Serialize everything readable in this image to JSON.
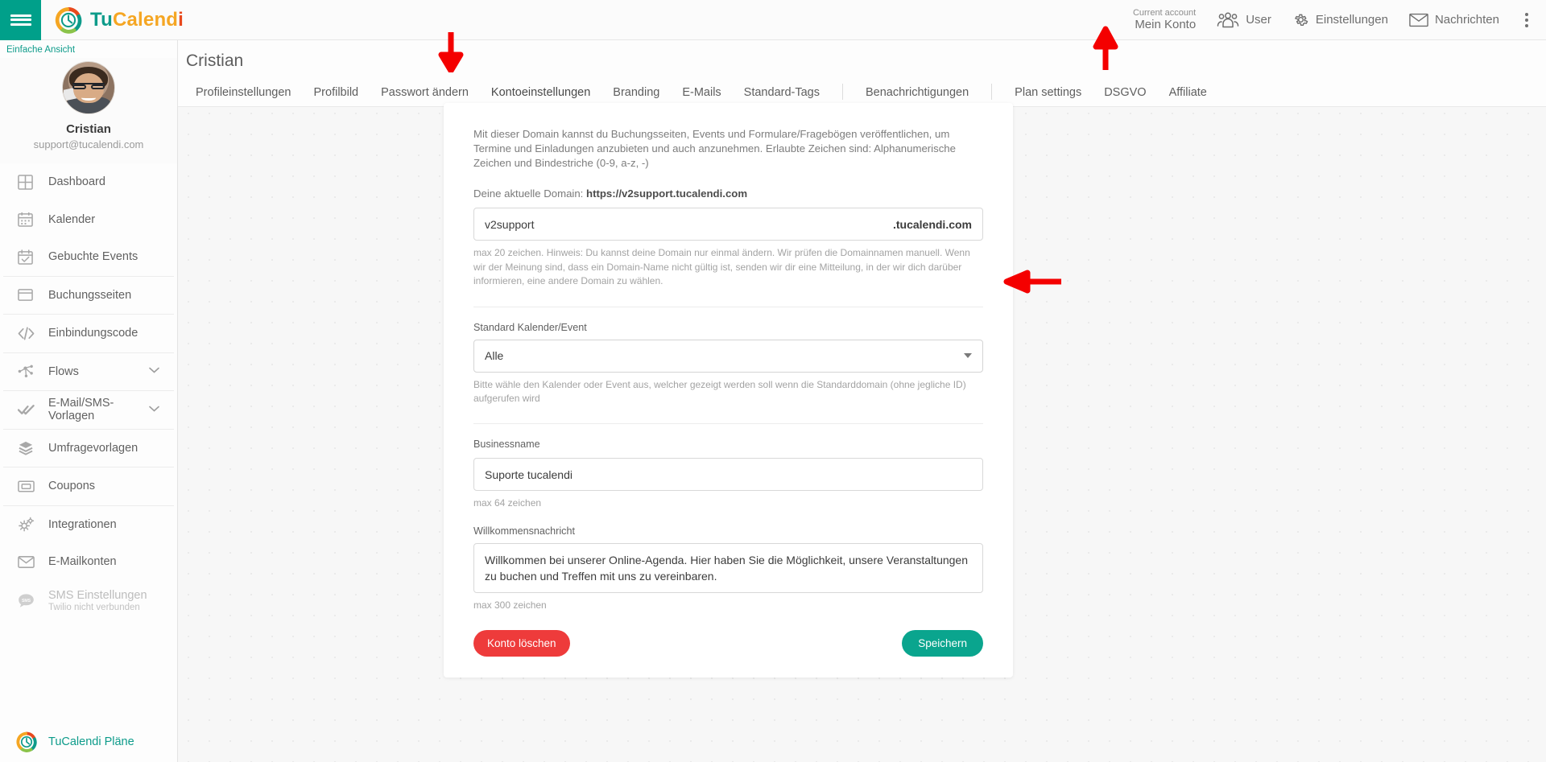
{
  "topbar": {
    "menu_icon": "hamburger-icon",
    "brand": {
      "part1": "Tu",
      "part2": "Calend",
      "part3": "i"
    },
    "account_label": "Current account",
    "account_name": "Mein Konto",
    "items": [
      {
        "label": "User",
        "icon": "users-icon"
      },
      {
        "label": "Einstellungen",
        "icon": "gear-icon"
      },
      {
        "label": "Nachrichten",
        "icon": "envelope-icon"
      }
    ],
    "overflow_icon": "kebab-menu-icon"
  },
  "sidebar": {
    "simple_view": "Einfache Ansicht",
    "profile": {
      "name": "Cristian",
      "email": "support@tucalendi.com",
      "avatar": "user-avatar"
    },
    "items": [
      {
        "label": "Dashboard",
        "icon": "grid-icon",
        "chevron": false,
        "disabled": false
      },
      {
        "label": "Kalender",
        "icon": "calendar-icon",
        "chevron": false,
        "disabled": false
      },
      {
        "label": "Gebuchte Events",
        "icon": "calendar-check-icon",
        "chevron": false,
        "disabled": false
      },
      {
        "label": "Buchungsseiten",
        "icon": "window-icon",
        "chevron": false,
        "disabled": false
      },
      {
        "label": "Einbindungscode",
        "icon": "code-icon",
        "chevron": false,
        "disabled": false
      },
      {
        "label": "Flows",
        "icon": "nodes-icon",
        "chevron": true,
        "disabled": false
      },
      {
        "label": "E-Mail/SMS-Vorlagen",
        "icon": "double-check-icon",
        "chevron": true,
        "disabled": false
      },
      {
        "label": "Umfragevorlagen",
        "icon": "layers-icon",
        "chevron": false,
        "disabled": false
      },
      {
        "label": "Coupons",
        "icon": "ticket-icon",
        "chevron": false,
        "disabled": false
      },
      {
        "label": "Integrationen",
        "icon": "gears-icon",
        "chevron": false,
        "disabled": false
      },
      {
        "label": "E-Mailkonten",
        "icon": "envelope-icon",
        "chevron": false,
        "disabled": false
      },
      {
        "label": "SMS Einstellungen",
        "sublabel": "Twilio nicht verbunden",
        "icon": "sms-bubble-icon",
        "chevron": false,
        "disabled": true
      }
    ],
    "plans_label": "TuCalendi Pläne",
    "plans_icon": "tucalendi-logo-icon"
  },
  "main": {
    "page_title": "Cristian",
    "tabs": [
      {
        "label": "Profileinstellungen",
        "active": false,
        "divider_after": false
      },
      {
        "label": "Profilbild",
        "active": false,
        "divider_after": false
      },
      {
        "label": "Passwort ändern",
        "active": false,
        "divider_after": false
      },
      {
        "label": "Kontoeinstellungen",
        "active": true,
        "divider_after": false
      },
      {
        "label": "Branding",
        "active": false,
        "divider_after": false
      },
      {
        "label": "E-Mails",
        "active": false,
        "divider_after": false
      },
      {
        "label": "Standard-Tags",
        "active": false,
        "divider_after": true
      },
      {
        "label": "Benachrichtigungen",
        "active": false,
        "divider_after": true
      },
      {
        "label": "Plan settings",
        "active": false,
        "divider_after": false
      },
      {
        "label": "DSGVO",
        "active": false,
        "divider_after": false
      },
      {
        "label": "Affiliate",
        "active": false,
        "divider_after": false
      }
    ]
  },
  "card": {
    "intro": "Mit dieser Domain kannst du Buchungsseiten, Events und Formulare/Fragebögen veröffentlichen, um Termine und Einladungen anzubieten und auch anzunehmen. Erlaubte Zeichen sind: Alphanumerische Zeichen und Bindestriche (0-9, a-z, -)",
    "current_domain_label": "Deine aktuelle Domain:",
    "current_domain_value": "https://v2support.tucalendi.com",
    "domain_input_value": "v2support",
    "domain_suffix": ".tucalendi.com",
    "domain_hint": "max 20 zeichen. Hinweis: Du kannst deine Domain nur einmal ändern. Wir prüfen die Domainnamen manuell. Wenn wir der Meinung sind, dass ein Domain-Name nicht gültig ist, senden wir dir eine Mitteilung, in der wir dich darüber informieren, eine andere Domain zu wählen.",
    "calendar_label": "Standard Kalender/Event",
    "calendar_value": "Alle",
    "calendar_hint": "Bitte wähle den Kalender oder Event aus, welcher gezeigt werden soll wenn die Standarddomain (ohne jegliche ID) aufgerufen wird",
    "business_label": "Businessname",
    "business_value": "Suporte tucalendi",
    "business_hint": "max 64 zeichen",
    "welcome_label": "Willkommensnachricht",
    "welcome_value": "Willkommen bei unserer Online-Agenda. Hier haben Sie die Möglichkeit, unsere Veranstaltungen zu buchen und Treffen mit uns zu vereinbaren.",
    "welcome_hint": "max 300 zeichen",
    "delete_button": "Konto löschen",
    "save_button": "Speichern"
  },
  "annotations": {
    "arrow_color": "#f40000",
    "arrows": [
      {
        "name": "arrow-down-kontoeinstellungen",
        "direction": "down"
      },
      {
        "name": "arrow-up-einstellungen",
        "direction": "up"
      },
      {
        "name": "arrow-left-calendar-select",
        "direction": "left"
      }
    ]
  },
  "colors": {
    "brand_teal": "#0d9b8a",
    "brand_orange": "#f5a623",
    "brand_red": "#e8491d",
    "save_green": "#0aa58e",
    "delete_red": "#ee3b3b"
  }
}
